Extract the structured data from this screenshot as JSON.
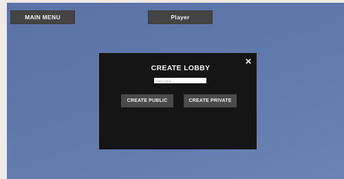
{
  "header": {
    "main_menu_label": "MAIN MENU",
    "player_label": "Player"
  },
  "modal": {
    "title": "CREATE LOBBY",
    "close_icon": "×",
    "lobby_name_placeholder": "Lobby Name",
    "lobby_name_value": "",
    "create_public_label": "CREATE PUBLIC",
    "create_private_label": "CREATE PRIVATE"
  },
  "colors": {
    "background": "#6078aa",
    "button": "#444444",
    "modal": "#151515",
    "page_border": "#efebe4"
  }
}
